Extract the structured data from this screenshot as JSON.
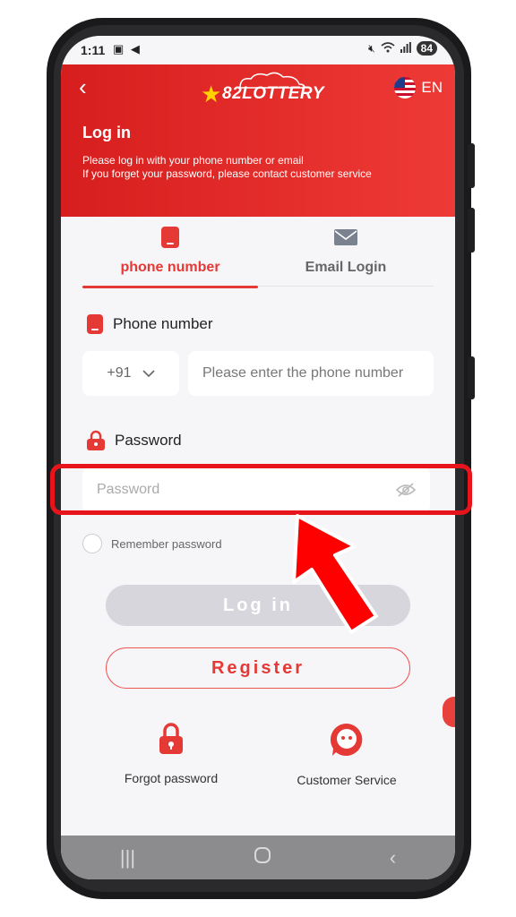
{
  "statusbar": {
    "time": "1:11",
    "battery": "84"
  },
  "header": {
    "logo_text": "82LOTTERY",
    "language": "EN",
    "title": "Log in",
    "line1": "Please log in with your phone number or email",
    "line2": "If you forget your password, please contact customer service"
  },
  "tabs": [
    {
      "label": "phone number",
      "icon": "phone-icon",
      "active": true
    },
    {
      "label": "Email Login",
      "icon": "mail-icon",
      "active": false
    }
  ],
  "phone_section": {
    "label": "Phone number",
    "country_code": "+91",
    "placeholder": "Please enter the phone number"
  },
  "password_section": {
    "label": "Password",
    "placeholder": "Password"
  },
  "remember_label": "Remember password",
  "buttons": {
    "login": "Log in",
    "register": "Register"
  },
  "bottom": {
    "forgot": "Forgot password",
    "service": "Customer Service"
  },
  "colors": {
    "accent": "#e53935",
    "highlight": "#e8141c"
  }
}
